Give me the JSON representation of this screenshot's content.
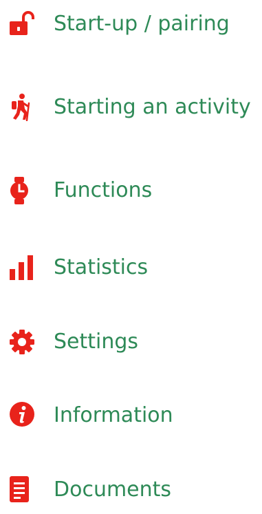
{
  "menu": {
    "accent_color": "#e8231b",
    "text_color": "#2e8a57",
    "items": [
      {
        "label": "Start-up / pairing",
        "icon": "unlock-icon"
      },
      {
        "label": "Starting an activity",
        "icon": "hiking-icon"
      },
      {
        "label": "Functions",
        "icon": "watch-icon"
      },
      {
        "label": "Statistics",
        "icon": "bar-chart-icon"
      },
      {
        "label": "Settings",
        "icon": "gear-icon"
      },
      {
        "label": "Information",
        "icon": "info-icon"
      },
      {
        "label": "Documents",
        "icon": "document-icon"
      }
    ]
  }
}
